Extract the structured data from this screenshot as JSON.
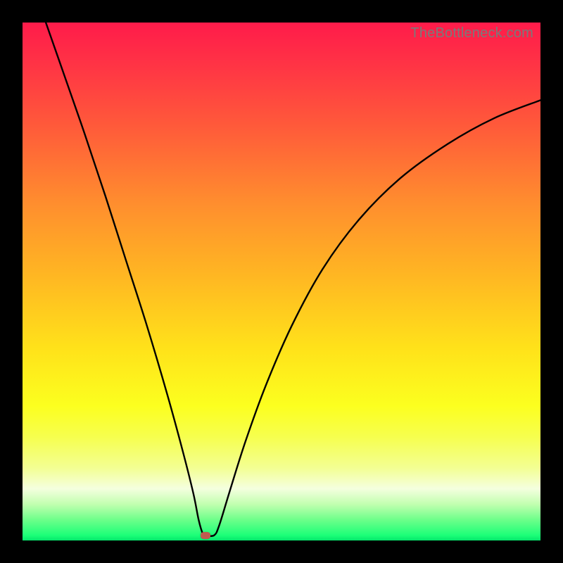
{
  "watermark": "TheBottleneck.com",
  "colors": {
    "frame": "#000000",
    "curve": "#000000",
    "marker": "#c15a4f",
    "gradient_stops": [
      {
        "pos": 0.0,
        "color": "#ff1b4a"
      },
      {
        "pos": 0.08,
        "color": "#ff3345"
      },
      {
        "pos": 0.2,
        "color": "#ff5a3a"
      },
      {
        "pos": 0.35,
        "color": "#ff8e2e"
      },
      {
        "pos": 0.48,
        "color": "#ffb423"
      },
      {
        "pos": 0.63,
        "color": "#ffe21a"
      },
      {
        "pos": 0.74,
        "color": "#fcff1f"
      },
      {
        "pos": 0.8,
        "color": "#f6ff4e"
      },
      {
        "pos": 0.86,
        "color": "#f3ff93"
      },
      {
        "pos": 0.9,
        "color": "#f4ffdf"
      },
      {
        "pos": 0.93,
        "color": "#c2ffb0"
      },
      {
        "pos": 0.96,
        "color": "#6dff8a"
      },
      {
        "pos": 0.99,
        "color": "#1cff78"
      },
      {
        "pos": 1.0,
        "color": "#04e66b"
      }
    ]
  },
  "chart_data": {
    "type": "line",
    "title": "",
    "xlabel": "",
    "ylabel": "",
    "xlim": [
      0,
      100
    ],
    "ylim": [
      0,
      100
    ],
    "marker": {
      "x": 35.3,
      "y": 1.0
    },
    "curve_points": [
      {
        "x": 4.5,
        "y": 100.0
      },
      {
        "x": 8.0,
        "y": 90.0
      },
      {
        "x": 12.0,
        "y": 78.5
      },
      {
        "x": 16.0,
        "y": 66.5
      },
      {
        "x": 20.0,
        "y": 54.0
      },
      {
        "x": 24.0,
        "y": 41.5
      },
      {
        "x": 28.0,
        "y": 28.0
      },
      {
        "x": 31.0,
        "y": 17.0
      },
      {
        "x": 33.0,
        "y": 9.0
      },
      {
        "x": 34.0,
        "y": 4.0
      },
      {
        "x": 34.8,
        "y": 1.3
      },
      {
        "x": 35.3,
        "y": 1.0
      },
      {
        "x": 37.0,
        "y": 1.0
      },
      {
        "x": 38.0,
        "y": 3.0
      },
      {
        "x": 40.0,
        "y": 9.5
      },
      {
        "x": 43.0,
        "y": 19.0
      },
      {
        "x": 47.0,
        "y": 30.0
      },
      {
        "x": 52.0,
        "y": 41.5
      },
      {
        "x": 58.0,
        "y": 52.5
      },
      {
        "x": 65.0,
        "y": 62.0
      },
      {
        "x": 73.0,
        "y": 70.0
      },
      {
        "x": 82.0,
        "y": 76.5
      },
      {
        "x": 91.0,
        "y": 81.5
      },
      {
        "x": 100.0,
        "y": 85.0
      }
    ]
  }
}
